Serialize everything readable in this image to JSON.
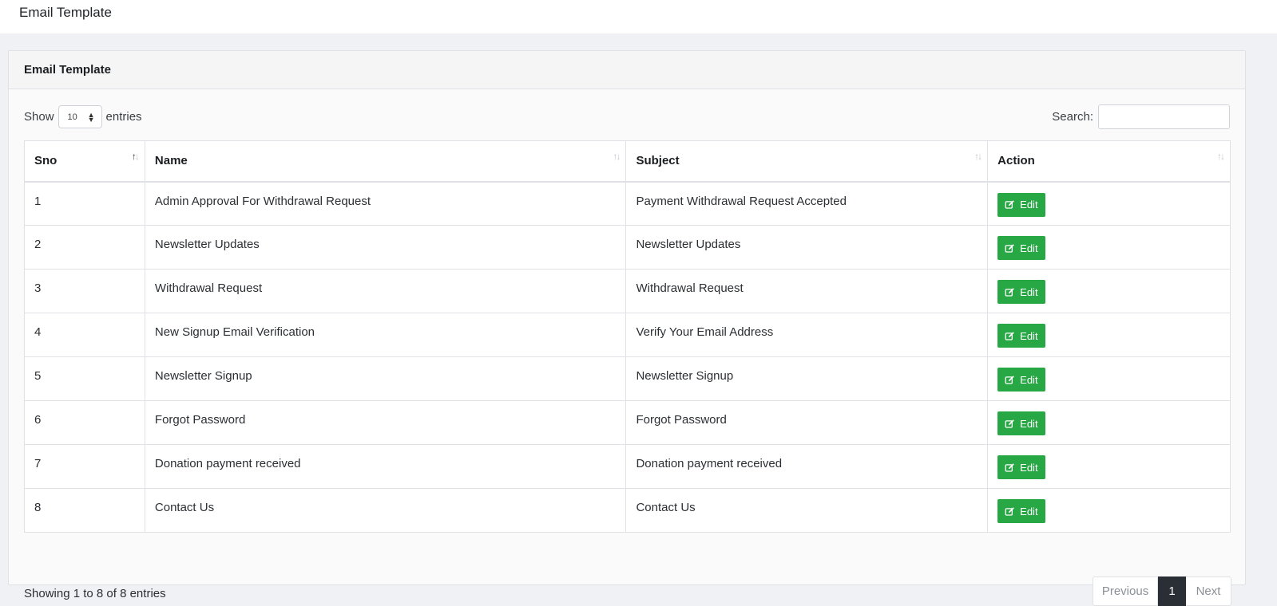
{
  "page": {
    "title": "Email Template"
  },
  "card": {
    "title": "Email Template"
  },
  "controls": {
    "show_label": "Show",
    "entries_value": "10",
    "entries_label": "entries",
    "search_label": "Search:",
    "search_value": "",
    "search_placeholder": ""
  },
  "table": {
    "columns": [
      "Sno",
      "Name",
      "Subject",
      "Action"
    ],
    "rows": [
      {
        "sno": "1",
        "name": "Admin Approval For Withdrawal Request",
        "subject": "Payment Withdrawal Request Accepted",
        "action": "Edit"
      },
      {
        "sno": "2",
        "name": "Newsletter Updates",
        "subject": "Newsletter Updates",
        "action": "Edit"
      },
      {
        "sno": "3",
        "name": "Withdrawal Request",
        "subject": "Withdrawal Request",
        "action": "Edit"
      },
      {
        "sno": "4",
        "name": "New Signup Email Verification",
        "subject": "Verify Your Email Address",
        "action": "Edit"
      },
      {
        "sno": "5",
        "name": "Newsletter Signup",
        "subject": "Newsletter Signup",
        "action": "Edit"
      },
      {
        "sno": "6",
        "name": "Forgot Password",
        "subject": "Forgot Password",
        "action": "Edit"
      },
      {
        "sno": "7",
        "name": "Donation payment received",
        "subject": "Donation payment received",
        "action": "Edit"
      },
      {
        "sno": "8",
        "name": "Contact Us",
        "subject": "Contact Us",
        "action": "Edit"
      }
    ]
  },
  "footer": {
    "info": "Showing 1 to 8 of 8 entries",
    "pagination": {
      "previous": "Previous",
      "current": "1",
      "next": "Next"
    }
  },
  "icons": {
    "edit": "edit-icon",
    "sort": "sort-icon",
    "select": "select-arrows-icon"
  },
  "colors": {
    "edit_button": "#28a745",
    "active_page": "#2a2f36"
  }
}
